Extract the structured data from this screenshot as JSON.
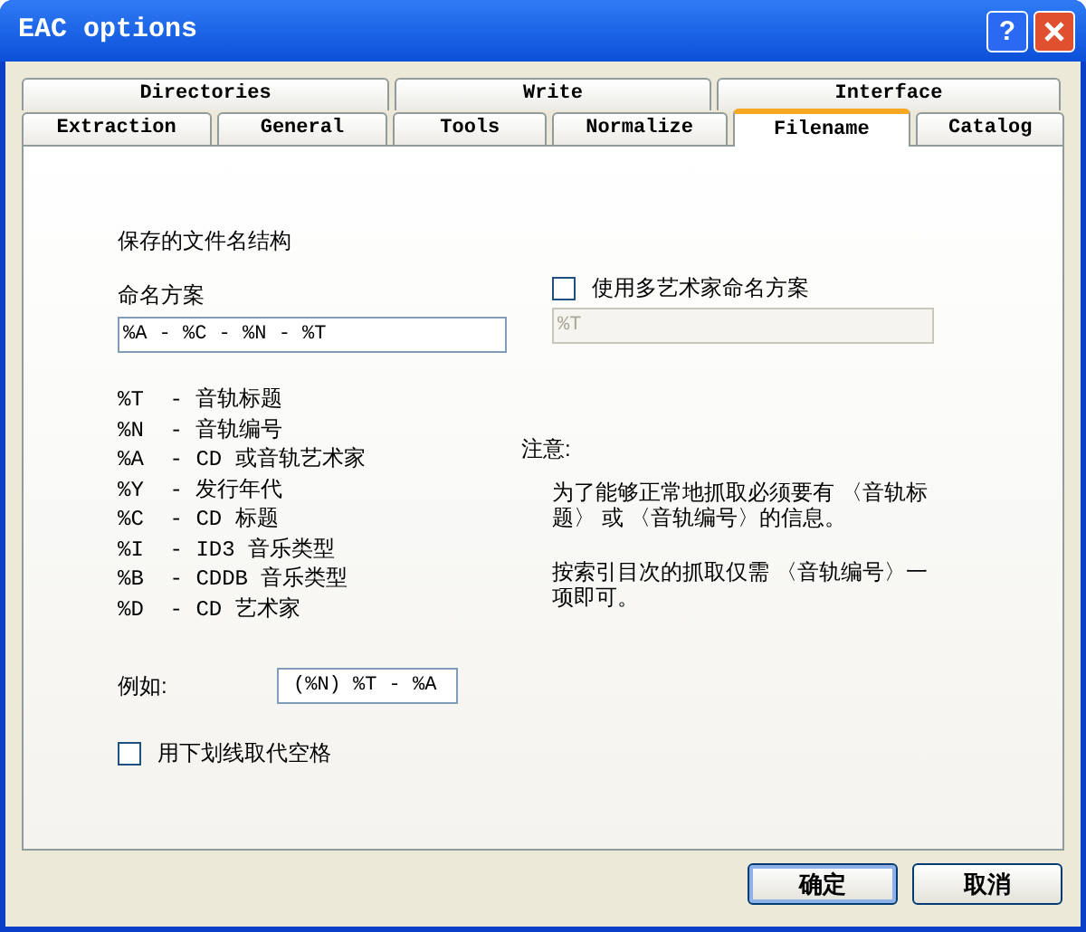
{
  "window": {
    "title": "EAC options",
    "help_button": "?"
  },
  "tab_rows": [
    [
      {
        "label": "Directories",
        "selected": false
      },
      {
        "label": "Write",
        "selected": false
      },
      {
        "label": "Interface",
        "selected": false
      }
    ],
    [
      {
        "label": "Extraction",
        "selected": false
      },
      {
        "label": "General",
        "selected": false
      },
      {
        "label": "Tools",
        "selected": false
      },
      {
        "label": "Normalize",
        "selected": false
      },
      {
        "label": "Filename",
        "selected": true
      },
      {
        "label": "Catalog",
        "selected": false
      }
    ]
  ],
  "filename_panel": {
    "heading": "保存的文件名结构",
    "naming_scheme": {
      "label": "命名方案",
      "value": "%A - %C - %N - %T"
    },
    "multi_artist": {
      "label": "使用多艺术家命名方案",
      "checked": false
    },
    "multi_artist_scheme": {
      "value": "%T",
      "disabled": true
    },
    "legend": [
      "%T  - 音轨标题",
      "%N  - 音轨编号",
      "%A  - CD 或音轨艺术家",
      "%Y  - 发行年代",
      "%C  - CD 标题",
      "%I  - ID3 音乐类型",
      "%B  - CDDB 音乐类型",
      "%D  - CD 艺术家"
    ],
    "note": {
      "title": "注意:",
      "paragraphs": [
        "为了能够正常地抓取必须要有 〈音轨标题〉 或 〈音轨编号〉的信息。",
        "按索引目次的抓取仅需 〈音轨编号〉一项即可。"
      ]
    },
    "example": {
      "label": "例如:",
      "value": "(%N) %T - %A"
    },
    "replace_spaces": {
      "label": "用下划线取代空格",
      "checked": false
    }
  },
  "buttons": [
    {
      "label": "确定",
      "default": true
    },
    {
      "label": "取消",
      "default": false
    }
  ]
}
